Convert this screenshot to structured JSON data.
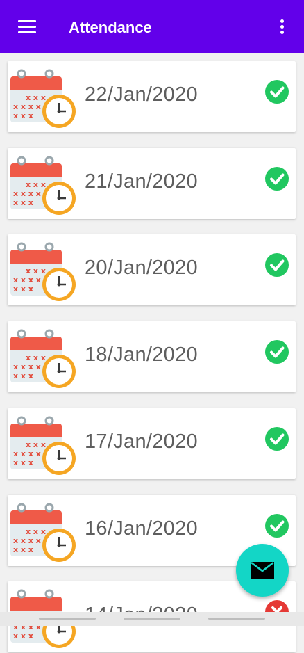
{
  "app_bar": {
    "title": "Attendance",
    "menu_icon": "hamburger-menu-icon",
    "more_icon": "more-vertical-icon"
  },
  "attendance": [
    {
      "date": "22/Jan/2020",
      "status": "present"
    },
    {
      "date": "21/Jan/2020",
      "status": "present"
    },
    {
      "date": "20/Jan/2020",
      "status": "present"
    },
    {
      "date": "18/Jan/2020",
      "status": "present"
    },
    {
      "date": "17/Jan/2020",
      "status": "present"
    },
    {
      "date": "16/Jan/2020",
      "status": "present"
    },
    {
      "date": "14/Jan/2020",
      "status": "absent"
    }
  ],
  "fab": {
    "icon": "mail-icon"
  },
  "colors": {
    "app_bar": "#6200ea",
    "present": "#21c760",
    "absent": "#e53935",
    "fab": "#13d6c6"
  }
}
